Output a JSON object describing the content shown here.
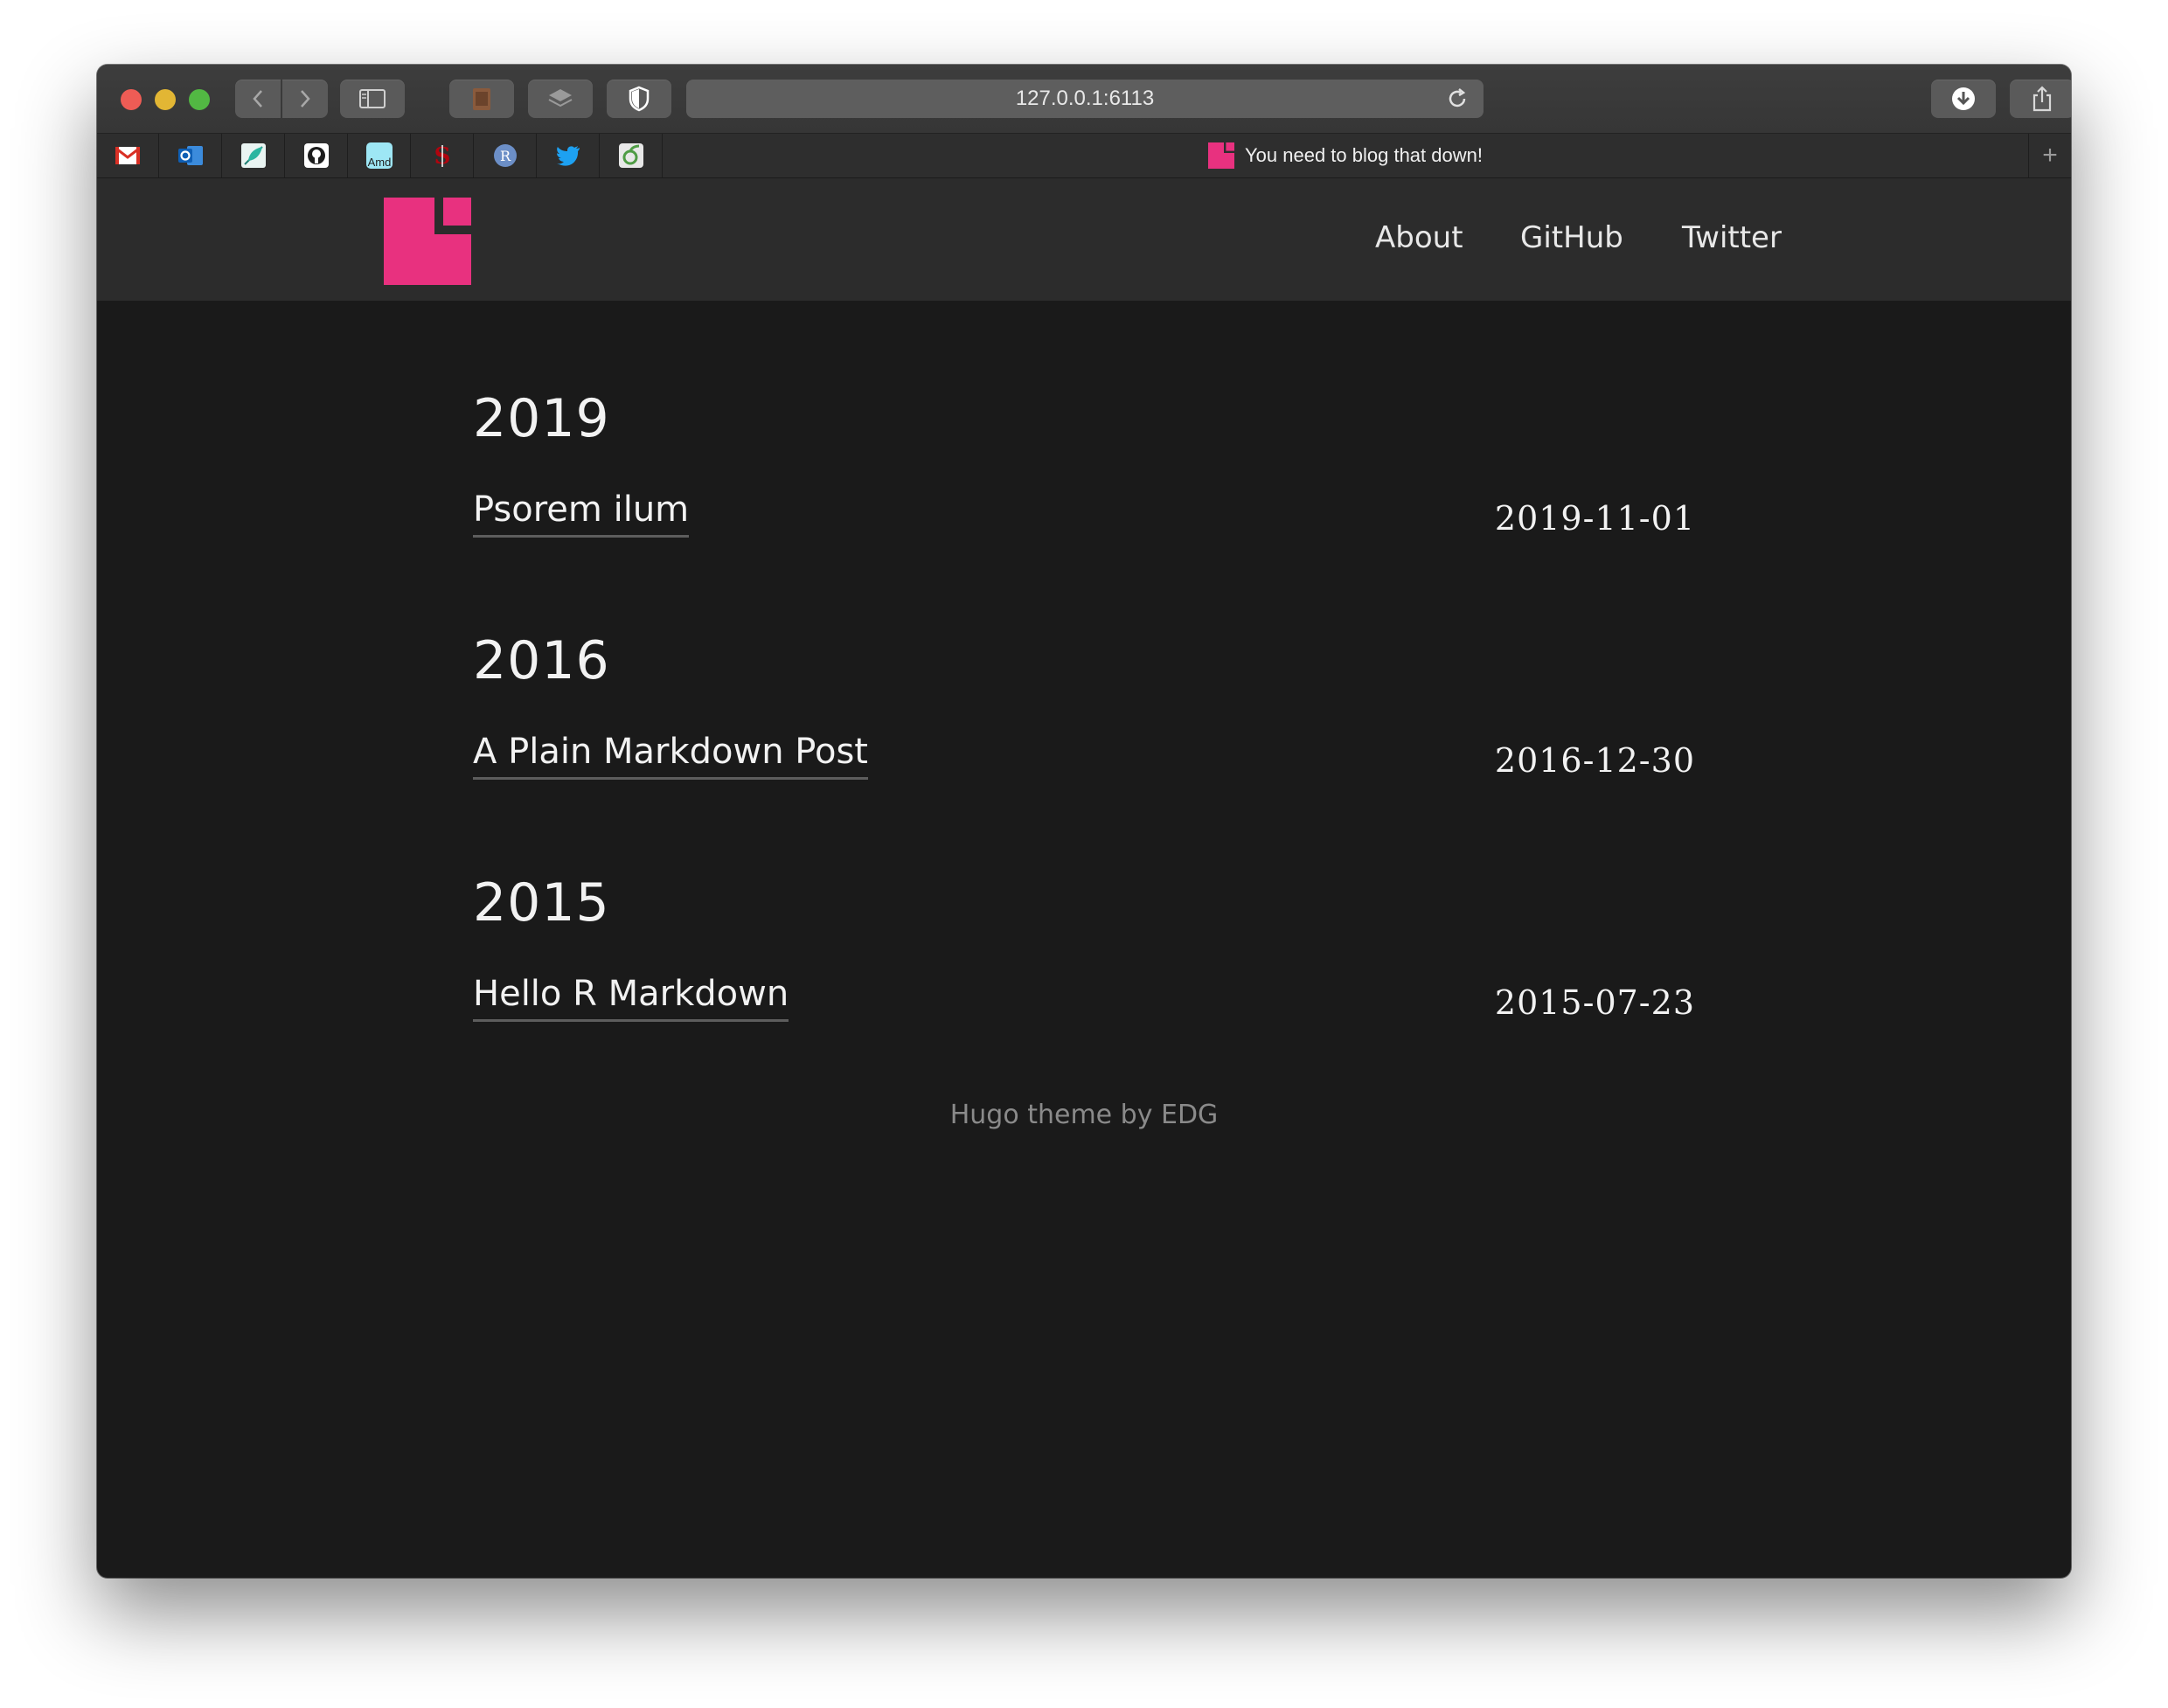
{
  "browser": {
    "url": "127.0.0.1:6113",
    "tab_title": "You need to blog that down!",
    "bookmarks": [
      {
        "icon": "gmail-icon",
        "color": "#d93025"
      },
      {
        "icon": "outlook-icon",
        "color": "#1a73e8"
      },
      {
        "icon": "feather-icon",
        "color": "#2bb5a0"
      },
      {
        "icon": "github-icon",
        "color": "#ffffff"
      },
      {
        "icon": "amd-icon",
        "color": "#9ee7f5",
        "text": "Amd"
      },
      {
        "icon": "stanford-icon",
        "color": "#b1040e"
      },
      {
        "icon": "r-icon",
        "color": "#6c8fc7",
        "text": "R"
      },
      {
        "icon": "twitter-icon",
        "color": "#1da1f2"
      },
      {
        "icon": "overleaf-icon",
        "color": "#4f9c45"
      }
    ]
  },
  "site": {
    "logo_color": "#e8317f",
    "nav": [
      {
        "label": "About"
      },
      {
        "label": "GitHub"
      },
      {
        "label": "Twitter"
      }
    ]
  },
  "archive": [
    {
      "year": "2019",
      "posts": [
        {
          "title": "Psorem ilum",
          "date": "2019-11-01"
        }
      ]
    },
    {
      "year": "2016",
      "posts": [
        {
          "title": "A Plain Markdown Post",
          "date": "2016-12-30"
        }
      ]
    },
    {
      "year": "2015",
      "posts": [
        {
          "title": "Hello R Markdown",
          "date": "2015-07-23"
        }
      ]
    }
  ],
  "footer": {
    "text": "Hugo theme by EDG"
  }
}
